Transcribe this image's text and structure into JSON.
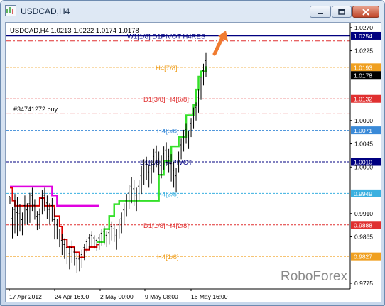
{
  "window": {
    "title": "USDCAD,H4"
  },
  "chart_info": {
    "header": "USDCAD,H4  1.0213 1.0222 1.0174 1.0178",
    "order_label": "#34741272 buy",
    "watermark": "RoboForex"
  },
  "colors": {
    "accent_arrow": "#f07b30",
    "price_box": "#000000",
    "green_indicator": "#35e02a",
    "red_indicator": "#e00000",
    "magenta_indicator": "#e000e0",
    "navy_level": "#000080"
  },
  "chart_data": {
    "type": "line",
    "ylim": [
      0.9764,
      1.0278
    ],
    "y_ticks": [
      "1.0270",
      "1.0225",
      "1.0090",
      "1.0045",
      "1.0000",
      "0.9910",
      "0.9865",
      "0.9775"
    ],
    "x_ticks": [
      "17 Apr 2012",
      "24 Apr 16:00",
      "2 May 00:00",
      "9 May 08:00",
      "16 May 16:00"
    ],
    "levels": [
      {
        "label": "W1[1/8] D1PIVOT H4RES",
        "value": 1.0254,
        "price": "1.0254",
        "color": "#000080",
        "style": "solid",
        "box": "#000080"
      },
      {
        "label": "",
        "value": 1.0244,
        "price": "",
        "color": "#e03030",
        "style": "dashdot",
        "box": ""
      },
      {
        "label": "H4[7/8]",
        "value": 1.0193,
        "price": "1.0193",
        "color": "#f0a020",
        "style": "dashed",
        "box": "#f0a020"
      },
      {
        "label": "",
        "value": 1.0178,
        "price": "1.0178",
        "color": "",
        "style": "none",
        "box": "#000000"
      },
      {
        "label": "D1[3/8] H4[6/8]",
        "value": 1.0132,
        "price": "1.0132",
        "color": "#e03030",
        "style": "dashed",
        "box": "#e03030"
      },
      {
        "label": "",
        "value": 1.0103,
        "price": "",
        "color": "#e03030",
        "style": "dashdot",
        "box": ""
      },
      {
        "label": "H4[5/8]",
        "value": 1.0071,
        "price": "1.0071",
        "color": "#3a8ad8",
        "style": "dashed",
        "box": "#3a8ad8"
      },
      {
        "label": "D1[2/8] H4PIVOT",
        "value": 1.001,
        "price": "1.0010",
        "color": "#000080",
        "style": "dashed",
        "box": "#000080"
      },
      {
        "label": "H4[3/8]",
        "value": 0.9949,
        "price": "0.9949",
        "color": "#3ab0e0",
        "style": "dashed",
        "box": "#3ab0e0"
      },
      {
        "label": "D1[1/8] H4[2/8]",
        "value": 0.9888,
        "price": "0.9888",
        "color": "#e03030",
        "style": "dashed",
        "box": "#e03030"
      },
      {
        "label": "H4[1/8]",
        "value": 0.9827,
        "price": "0.9827",
        "color": "#f0a020",
        "style": "dashed",
        "box": "#f0a020"
      }
    ],
    "candles_hl": [
      [
        0.9942,
        0.9928
      ],
      [
        0.9922,
        0.9862
      ],
      [
        0.9948,
        0.9872
      ],
      [
        0.9942,
        0.9866
      ],
      [
        0.9928,
        0.9875
      ],
      [
        0.9912,
        0.9868
      ],
      [
        0.9945,
        0.989
      ],
      [
        0.993,
        0.9888
      ],
      [
        0.995,
        0.9892
      ],
      [
        0.996,
        0.9915
      ],
      [
        0.9938,
        0.9898
      ],
      [
        0.9915,
        0.9878
      ],
      [
        0.992,
        0.988
      ],
      [
        0.9955,
        0.9908
      ],
      [
        0.996,
        0.9915
      ],
      [
        0.9945,
        0.99
      ],
      [
        0.993,
        0.989
      ],
      [
        0.994,
        0.9895
      ],
      [
        0.992,
        0.986
      ],
      [
        0.99,
        0.986
      ],
      [
        0.988,
        0.9845
      ],
      [
        0.987,
        0.983
      ],
      [
        0.9862,
        0.9822
      ],
      [
        0.986,
        0.9812
      ],
      [
        0.9848,
        0.9802
      ],
      [
        0.9858,
        0.9815
      ],
      [
        0.9845,
        0.981
      ],
      [
        0.9835,
        0.9795
      ],
      [
        0.983,
        0.9798
      ],
      [
        0.984,
        0.9805
      ],
      [
        0.9852,
        0.982
      ],
      [
        0.986,
        0.9835
      ],
      [
        0.987,
        0.984
      ],
      [
        0.9875,
        0.9845
      ],
      [
        0.9868,
        0.9842
      ],
      [
        0.9862,
        0.9838
      ],
      [
        0.987,
        0.984
      ],
      [
        0.988,
        0.9848
      ],
      [
        0.9885,
        0.985
      ],
      [
        0.9875,
        0.9845
      ],
      [
        0.988,
        0.985
      ],
      [
        0.9895,
        0.9858
      ],
      [
        0.989,
        0.9855
      ],
      [
        0.988,
        0.984
      ],
      [
        0.99,
        0.9862
      ],
      [
        0.9912,
        0.9872
      ],
      [
        0.993,
        0.9888
      ],
      [
        0.9948,
        0.9905
      ],
      [
        0.9965,
        0.9918
      ],
      [
        0.998,
        0.993
      ],
      [
        0.9975,
        0.9925
      ],
      [
        0.996,
        0.9915
      ],
      [
        0.9975,
        0.9935
      ],
      [
        1.0002,
        0.9948
      ],
      [
        1.0015,
        0.9965
      ],
      [
        1.002,
        0.9975
      ],
      [
        1.0005,
        0.996
      ],
      [
        1.0012,
        0.9968
      ],
      [
        1.0035,
        0.999
      ],
      [
        1.0042,
        1.0
      ],
      [
        1.003,
        0.9985
      ],
      [
        1.0022,
        0.9978
      ],
      [
        1.004,
        0.9995
      ],
      [
        1.0048,
        1.0002
      ],
      [
        1.0035,
        0.999
      ],
      [
        1.0025,
        0.9972
      ],
      [
        1.001,
        0.996
      ],
      [
        0.9998,
        0.9952
      ],
      [
        1.003,
        0.999
      ],
      [
        1.0055,
        1.0015
      ],
      [
        1.0072,
        1.003
      ],
      [
        1.0085,
        1.0045
      ],
      [
        1.007,
        1.0035
      ],
      [
        1.0095,
        1.0058
      ],
      [
        1.0115,
        1.0075
      ],
      [
        1.0125,
        1.009
      ],
      [
        1.015,
        1.0105
      ],
      [
        1.0175,
        1.013
      ],
      [
        1.02,
        1.0158
      ],
      [
        1.0222,
        1.0174
      ]
    ],
    "green_line": [
      [
        0.9862,
        0.9862
      ],
      [
        0.9862,
        0.9862
      ],
      [
        0.9862,
        0.9862
      ],
      [
        0.9862,
        0.9862
      ],
      [
        0.9862,
        0.9862
      ],
      [
        0.9862,
        0.9862
      ],
      [
        0.9862,
        0.9862
      ],
      [
        0.9862,
        0.9862
      ],
      [
        0.9862,
        0.9862
      ],
      [
        0.9862,
        0.9862
      ]
    ],
    "green_steps": [
      [
        35,
        0.9855
      ],
      [
        38,
        0.988
      ],
      [
        40,
        0.9905
      ],
      [
        42,
        0.9928
      ],
      [
        44,
        0.9935
      ],
      [
        46,
        0.9935
      ],
      [
        49,
        0.9935
      ],
      [
        55,
        0.9935
      ],
      [
        59,
        0.9935
      ],
      [
        60,
        0.9985
      ],
      [
        62,
        1.0012
      ],
      [
        64,
        1.0012
      ],
      [
        65,
        1.004
      ],
      [
        67,
        1.004
      ],
      [
        68,
        1.0058
      ],
      [
        70,
        1.0058
      ],
      [
        71,
        1.01
      ],
      [
        72,
        1.01
      ],
      [
        73,
        1.01
      ],
      [
        74,
        1.012
      ],
      [
        75,
        1.015
      ],
      [
        76,
        1.0175
      ],
      [
        77,
        1.0185
      ],
      [
        79,
        1.0195
      ]
    ],
    "red_steps": [
      [
        0,
        0.996
      ],
      [
        1,
        0.9935
      ],
      [
        2,
        0.9925
      ],
      [
        10,
        0.9925
      ],
      [
        12,
        0.994
      ],
      [
        14,
        0.9925
      ],
      [
        18,
        0.9905
      ],
      [
        20,
        0.9885
      ],
      [
        21,
        0.986
      ],
      [
        23,
        0.9845
      ],
      [
        26,
        0.9835
      ],
      [
        28,
        0.9825
      ],
      [
        30,
        0.984
      ],
      [
        32,
        0.9845
      ],
      [
        34,
        0.9845
      ],
      [
        35,
        0.985
      ]
    ],
    "magenta_steps": [
      [
        0,
        0.9962
      ],
      [
        16,
        0.9962
      ],
      [
        17,
        0.9945
      ],
      [
        19,
        0.9925
      ],
      [
        36,
        0.9925
      ]
    ]
  }
}
